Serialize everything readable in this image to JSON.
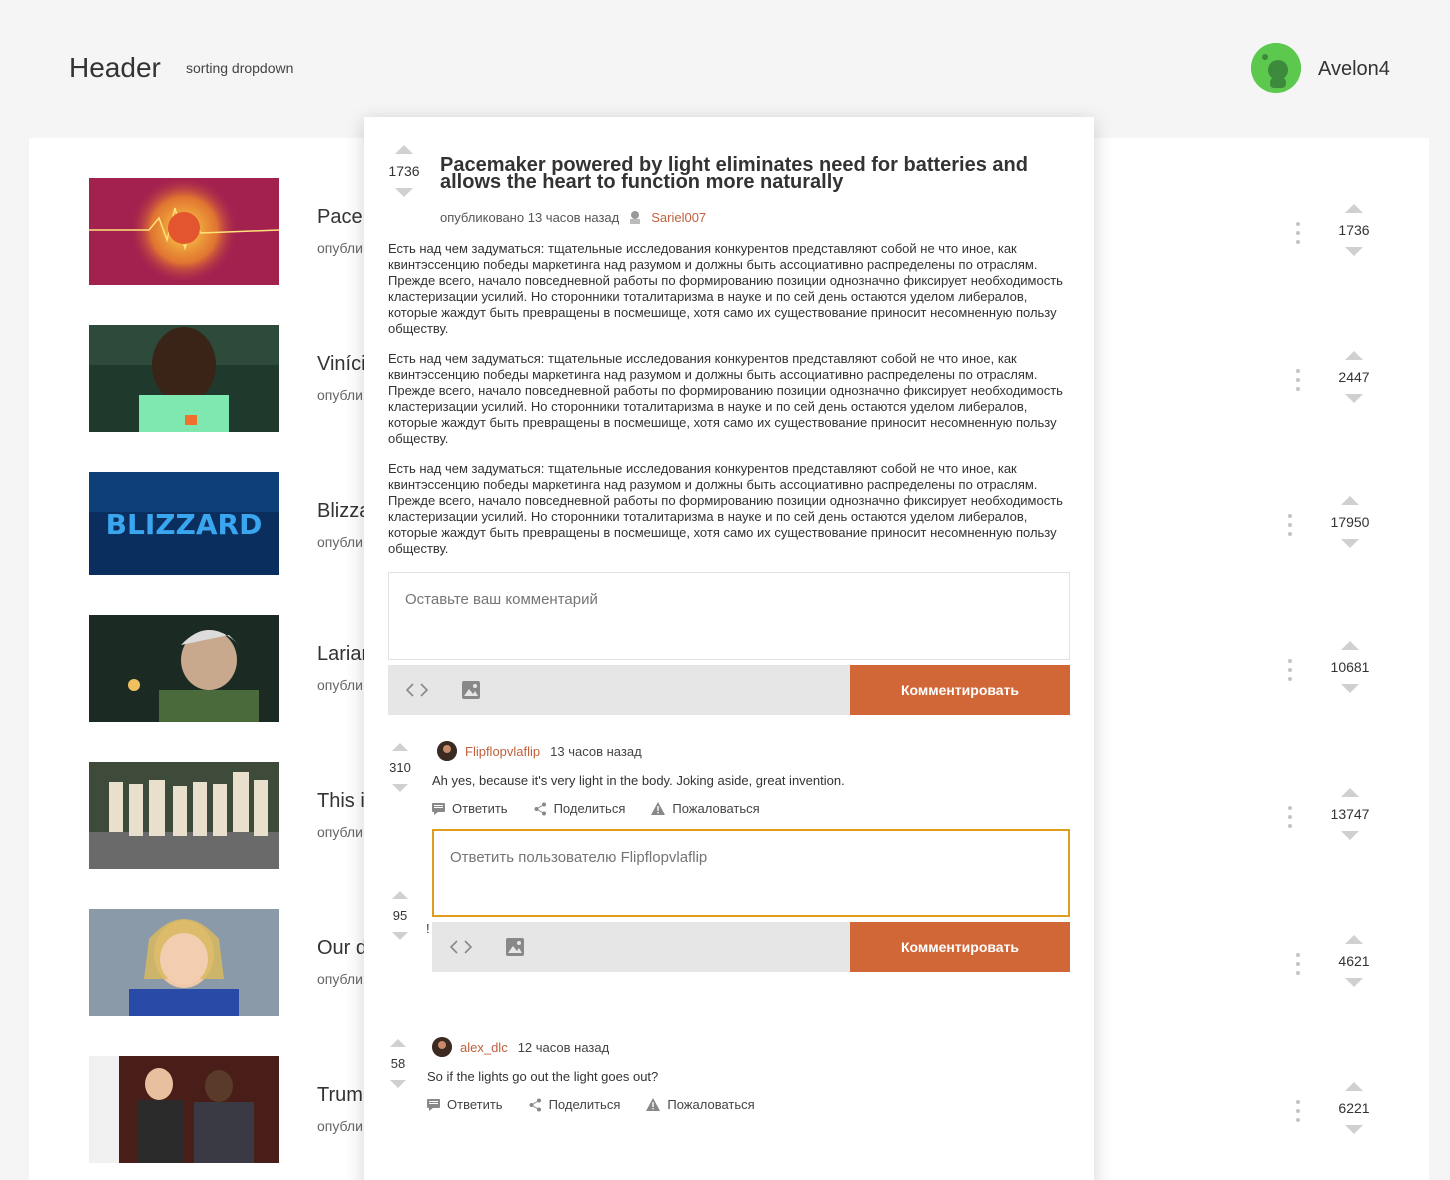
{
  "header": {
    "title": "Header",
    "sorting_label": "sorting dropdown",
    "username": "Avelon4"
  },
  "feed": {
    "items": [
      {
        "title": "Pacer",
        "meta": "опубли",
        "votes": "1736"
      },
      {
        "title": "Viníci",
        "meta": "опубли",
        "votes": "2447"
      },
      {
        "title": "Blizza",
        "meta": "опубли",
        "votes": "17950"
      },
      {
        "title": "Larian",
        "meta": "опубли",
        "votes": "10681"
      },
      {
        "title": "This i",
        "meta": "опубли",
        "votes": "13747"
      },
      {
        "title": "Our d",
        "meta": "опубли",
        "votes": "4621"
      },
      {
        "title": "Trum",
        "meta": "опубли",
        "votes": "6221"
      }
    ]
  },
  "post": {
    "votes": "1736",
    "title": "Pacemaker powered by light eliminates need for batteries and allows the heart to function more naturally",
    "published_label": "опубликовано",
    "time": "13 часов назад",
    "author": "Sariel007",
    "paragraphs": [
      "Есть над чем задуматься: тщательные исследования конкурентов представляют собой не что иное, как квинтэссенцию победы маркетинга над разумом и должны быть ассоциативно распределены по отраслям. Прежде всего, начало повседневной работы по формированию позиции однозначно фиксирует необходимость кластеризации усилий. Но сторонники тоталитаризма в науке и по сей день остаются уделом либералов, которые жаждут быть превращены в посмешище, хотя само их существование приносит несомненную пользу обществу.",
      "Есть над чем задуматься: тщательные исследования конкурентов представляют собой не что иное, как квинтэссенцию победы маркетинга над разумом и должны быть ассоциативно распределены по отраслям. Прежде всего, начало повседневной работы по формированию позиции однозначно фиксирует необходимость кластеризации усилий. Но сторонники тоталитаризма в науке и по сей день остаются уделом либералов, которые жаждут быть превращены в посмешище, хотя само их существование приносит несомненную пользу обществу.",
      "Есть над чем задуматься: тщательные исследования конкурентов представляют собой не что иное, как квинтэссенцию победы маркетинга над разумом и должны быть ассоциативно распределены по отраслям. Прежде всего, начало повседневной работы по формированию позиции однозначно фиксирует необходимость кластеризации усилий. Но сторонники тоталитаризма в науке и по сей день остаются уделом либералов, которые жаждут быть превращены в посмешище, хотя само их существование приносит несомненную пользу обществу."
    ]
  },
  "comment_form": {
    "placeholder": "Оставьте ваш комментарий",
    "submit_label": "Комментировать"
  },
  "reply_form": {
    "placeholder": "Ответить пользователю Flipflopvlaflip",
    "submit_label": "Комментировать"
  },
  "comments": [
    {
      "votes": "310",
      "user": "Flipflopvlaflip",
      "time": "13 часов назад",
      "text": "Ah yes, because it's very light in the body. Joking aside, great invention."
    },
    {
      "votes": "95",
      "partial_text": "!"
    },
    {
      "votes": "58",
      "user": "alex_dlc",
      "time": "12 часов назад",
      "text": "So if the lights go out the light goes out?"
    }
  ],
  "actions": {
    "reply": "Ответить",
    "share": "Поделиться",
    "report": "Пожаловаться"
  }
}
